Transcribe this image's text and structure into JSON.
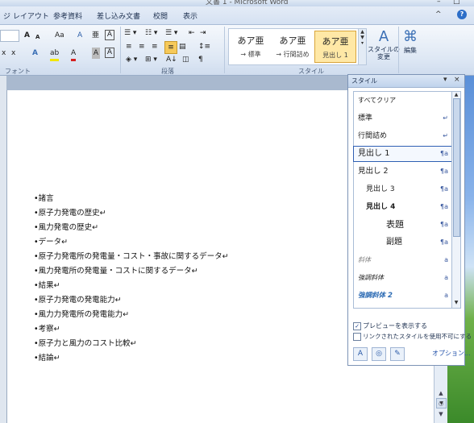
{
  "window": {
    "title": "文書 1 - Microsoft Word",
    "minimize": "–",
    "maximize": "□"
  },
  "tabs": [
    "ジ レイアウト",
    "参考資料",
    "差し込み文書",
    "校閲",
    "表示"
  ],
  "ribbon": {
    "ribbon_min": "^",
    "help": "?",
    "font_group_label": "フォント",
    "paragraph_group_label": "段落",
    "style_group_label": "スタイル",
    "grow_font": "A",
    "shrink_font": "A",
    "change_case": "Aa",
    "clear_format": "A",
    "phonetic": "亜",
    "enclose": "A",
    "subscript": "x",
    "superscript": "x",
    "text_effect": "A",
    "highlight": "ab",
    "font_color": "A",
    "char_shade": "A",
    "gallery": [
      {
        "big": "あア亜",
        "small": "→ 標準"
      },
      {
        "big": "あア亜",
        "small": "→ 行間詰め"
      },
      {
        "big": "あア亜",
        "small": "見出し 1"
      }
    ],
    "change_styles": "スタイルの\n変更",
    "edit": "編集"
  },
  "document": {
    "lines": [
      "•諸言",
      "•原子力発電の歴史↵",
      "•風力発電の歴史↵",
      "•データ↵",
      "•原子力発電所の発電量・コスト・事故に関するデータ↵",
      "•風力発電所の発電量・コストに関するデータ↵",
      "•結果↵",
      "•原子力発電の発電能力↵",
      "•風力力発電所の発電能力↵",
      "•考察↵",
      "•原子力と風力のコスト比較↵",
      "•結論↵"
    ]
  },
  "styles_pane": {
    "title": "スタイル",
    "items": [
      {
        "name": "すべてクリア",
        "mark": ""
      },
      {
        "name": "標準",
        "mark": "↵"
      },
      {
        "name": "行間詰め",
        "mark": "↵"
      },
      {
        "name": "見出し 1",
        "mark": "¶a"
      },
      {
        "name": "見出し 2",
        "mark": "¶a"
      },
      {
        "name": "見出し 3",
        "mark": "¶a"
      },
      {
        "name": "見出し 4",
        "mark": "¶a"
      },
      {
        "name": "表題",
        "mark": "¶a"
      },
      {
        "name": "副題",
        "mark": "¶a"
      },
      {
        "name": "斜体",
        "mark": "a"
      },
      {
        "name": "強調斜体",
        "mark": "a"
      },
      {
        "name": "強調斜体 2",
        "mark": "a"
      }
    ],
    "show_preview": "プレビューを表示する",
    "disable_linked": "リンクされたスタイルを使用不可にする",
    "options": "オプション..."
  }
}
